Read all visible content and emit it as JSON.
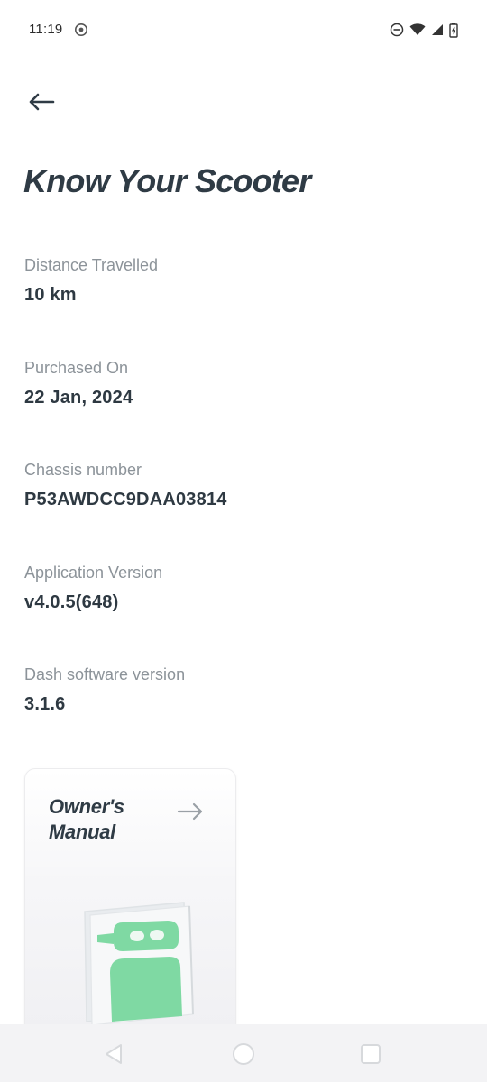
{
  "status_bar": {
    "time": "11:19",
    "icons": [
      "chrome-icon",
      "do-not-disturb-icon",
      "wifi-icon",
      "signal-icon",
      "battery-charging-icon"
    ]
  },
  "header": {
    "back_icon": "arrow-left-icon",
    "title": "Know Your Scooter"
  },
  "info": [
    {
      "label": "Distance Travelled",
      "value": "10 km"
    },
    {
      "label": "Purchased On",
      "value": "22 Jan, 2024"
    },
    {
      "label": "Chassis number",
      "value": "P53AWDCC9DAA03814"
    },
    {
      "label": "Application Version",
      "value": "v4.0.5(648)"
    },
    {
      "label": "Dash software version",
      "value": "3.1.6"
    }
  ],
  "manual_card": {
    "title": "Owner's Manual",
    "arrow_icon": "arrow-right-icon",
    "illustration": "manual-book-illustration"
  },
  "nav_bar": {
    "icons": [
      "nav-back-icon",
      "nav-home-icon",
      "nav-recents-icon"
    ]
  },
  "colors": {
    "title_text": "#2f3b45",
    "label_text": "#8c9399",
    "value_text": "#2e3942",
    "accent_green": "#7fd9a3",
    "nav_bg": "#f3f3f5"
  }
}
